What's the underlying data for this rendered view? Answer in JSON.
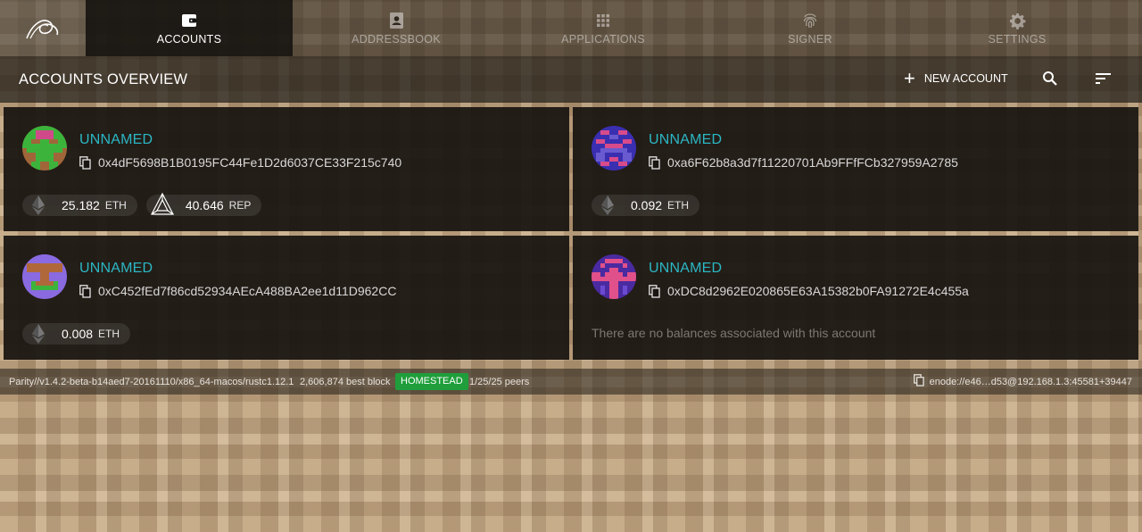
{
  "nav": {
    "tabs": [
      {
        "label": "ACCOUNTS",
        "icon": "wallet-icon",
        "active": true
      },
      {
        "label": "ADDRESSBOOK",
        "icon": "contacts-icon",
        "active": false
      },
      {
        "label": "APPLICATIONS",
        "icon": "apps-grid-icon",
        "active": false
      },
      {
        "label": "SIGNER",
        "icon": "fingerprint-icon",
        "active": false
      },
      {
        "label": "SETTINGS",
        "icon": "gear-icon",
        "active": false
      }
    ]
  },
  "header": {
    "title": "ACCOUNTS OVERVIEW",
    "new_account_label": "NEW ACCOUNT"
  },
  "accounts": [
    {
      "name": "UNNAMED",
      "address": "0x4dF5698B1B0195FC44Fe1D2d6037CE33F215c740",
      "balances": [
        {
          "value": "25.182",
          "symbol": "ETH",
          "icon": "ethereum-icon"
        },
        {
          "value": "40.646",
          "symbol": "REP",
          "icon": "augur-rep-icon"
        }
      ]
    },
    {
      "name": "UNNAMED",
      "address": "0xa6F62b8a3d7f11220701Ab9FFfFCb327959A2785",
      "balances": [
        {
          "value": "0.092",
          "symbol": "ETH",
          "icon": "ethereum-icon"
        }
      ]
    },
    {
      "name": "UNNAMED",
      "address": "0xC452fEd7f86cd52934AEcA488BA2ee1d11D962CC",
      "balances": [
        {
          "value": "0.008",
          "symbol": "ETH",
          "icon": "ethereum-icon"
        }
      ]
    },
    {
      "name": "UNNAMED",
      "address": "0xDC8d2962E020865E63A15382b0FA91272E4c455a",
      "balances": [],
      "no_balance_text": "There are no balances associated with this account"
    }
  ],
  "status": {
    "version": "Parity//v1.4.2-beta-b14aed7-20161110/x86_64-macos/rustc1.12.1",
    "block": "2,606,874 best block",
    "chain": "HOMESTEAD",
    "peers": "1/25/25 peers",
    "enode": "enode://e46…d53@192.168.1.3:45581+39447"
  },
  "colors": {
    "accent": "#2bb7c4",
    "chain_badge": "#1f9e3b"
  }
}
